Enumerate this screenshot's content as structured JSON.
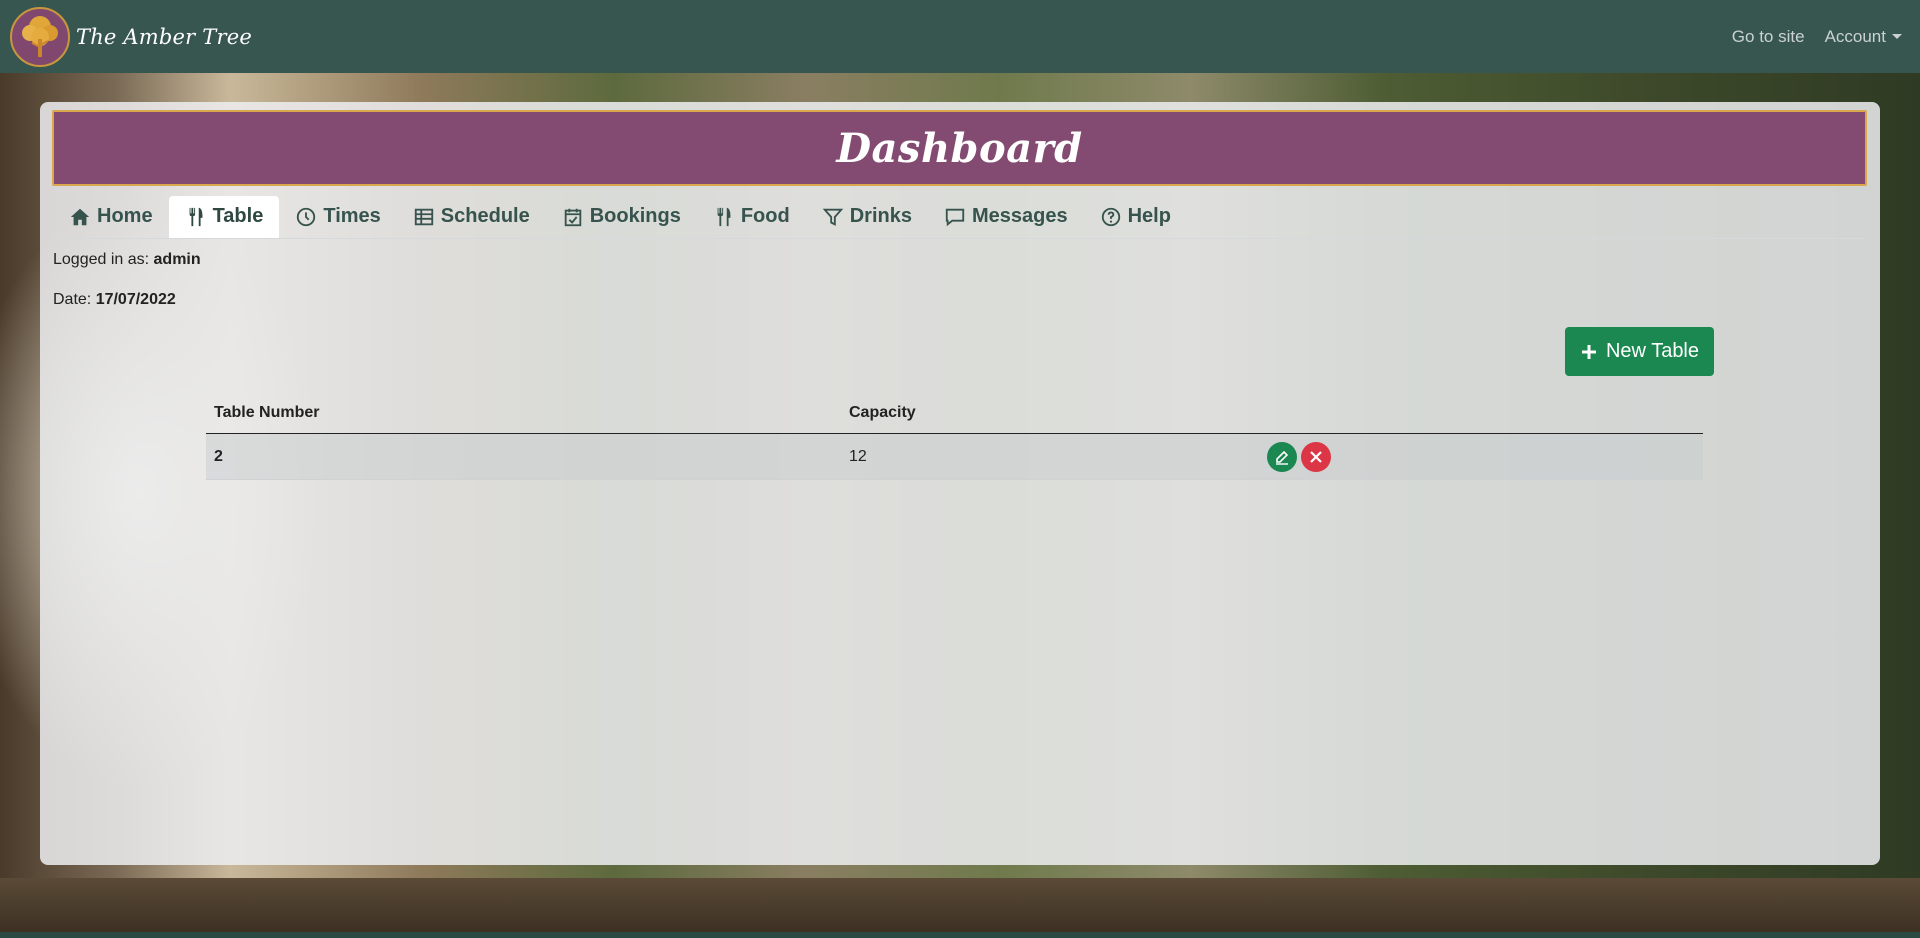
{
  "navbar": {
    "brand_name": "The Amber Tree",
    "go_to_site": "Go to site",
    "account": "Account"
  },
  "page": {
    "title": "Dashboard"
  },
  "tabs": [
    {
      "label": "Home",
      "icon": "home-icon",
      "active": false
    },
    {
      "label": "Table",
      "icon": "utensils-icon",
      "active": true
    },
    {
      "label": "Times",
      "icon": "clock-icon",
      "active": false
    },
    {
      "label": "Schedule",
      "icon": "table-grid-icon",
      "active": false
    },
    {
      "label": "Bookings",
      "icon": "calendar-check-icon",
      "active": false
    },
    {
      "label": "Food",
      "icon": "utensils-icon",
      "active": false
    },
    {
      "label": "Drinks",
      "icon": "filter-glass-icon",
      "active": false
    },
    {
      "label": "Messages",
      "icon": "message-icon",
      "active": false
    },
    {
      "label": "Help",
      "icon": "question-circle-icon",
      "active": false
    }
  ],
  "meta": {
    "user_label": "Logged in as: ",
    "user_value": "admin",
    "date_label": "Date: ",
    "date_value": "17/07/2022"
  },
  "actions": {
    "new_table": "New Table"
  },
  "table": {
    "headers": [
      "Table Number",
      "Capacity",
      ""
    ],
    "rows": [
      {
        "number": "2",
        "capacity": "12"
      }
    ]
  },
  "colors": {
    "navbar": "#385650",
    "title_band": "#834b71",
    "title_border": "#d9a84e",
    "accent_green": "#1b8751",
    "danger_red": "#dc3545"
  }
}
